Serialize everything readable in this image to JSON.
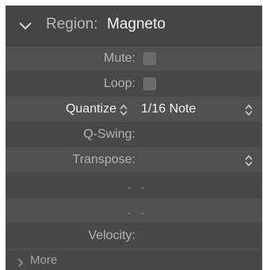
{
  "header": {
    "title_label": "Region:",
    "title_value": "Magneto",
    "toggle_icon": "chevron-down-icon"
  },
  "rows": {
    "mute": {
      "label": "Mute:",
      "checked": false
    },
    "loop": {
      "label": "Loop:",
      "checked": false
    },
    "quantize": {
      "label": "Quantize",
      "value": "1/16 Note"
    },
    "qswing": {
      "label": "Q-Swing:"
    },
    "transpose": {
      "label": "Transpose:"
    },
    "blank1": {
      "text": "- -"
    },
    "blank2": {
      "text": "- -"
    },
    "velocity": {
      "label": "Velocity:"
    }
  },
  "more": {
    "label": "More",
    "icon": "chevron-right-icon"
  },
  "colors": {
    "panel": "#505050",
    "header": "#454545",
    "text": "#f3f3f3",
    "muted": "#b3b3b3"
  }
}
